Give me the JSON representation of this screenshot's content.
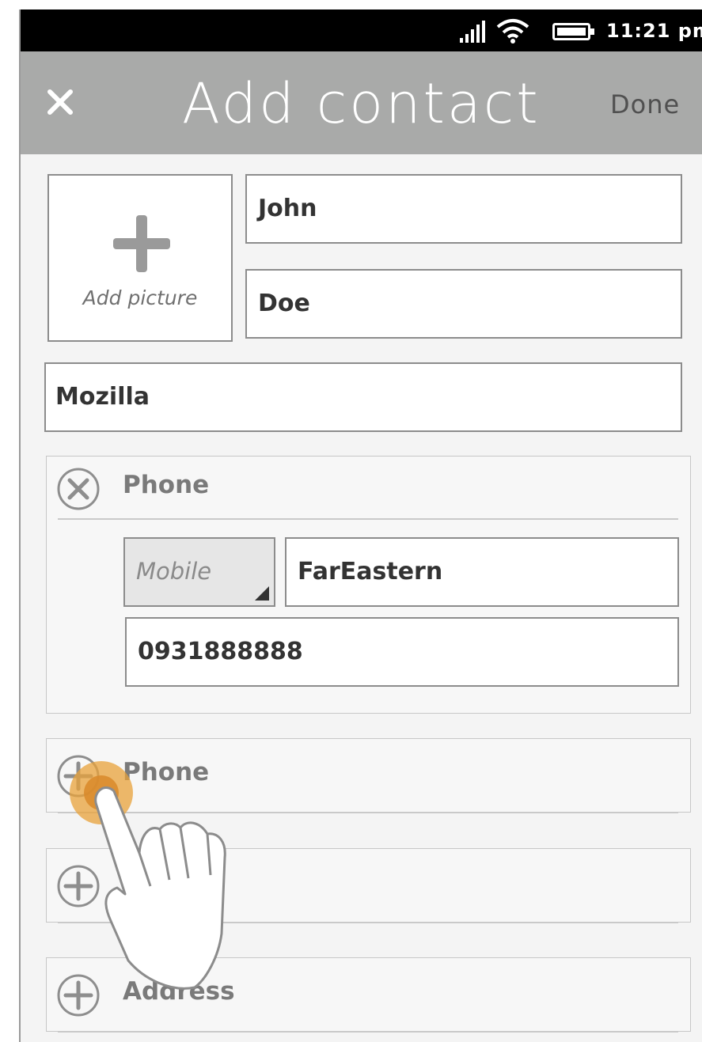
{
  "status_bar": {
    "time": "11:21 pm",
    "icons": [
      "signal-icon",
      "wifi-icon",
      "battery-icon"
    ]
  },
  "header": {
    "title": "Add contact",
    "done_label": "Done",
    "close_icon": "close-icon"
  },
  "avatar": {
    "label": "Add picture",
    "icon": "plus-icon"
  },
  "fields": {
    "given_name": "John",
    "family_name": "Doe",
    "company": "Mozilla"
  },
  "phone_section": {
    "label": "Phone",
    "remove_icon": "remove-circle-icon",
    "type_selected": "Mobile",
    "carrier": "FarEastern",
    "number": "0931888888"
  },
  "add_sections": [
    {
      "label": "Phone",
      "icon": "add-circle-icon"
    },
    {
      "label": "",
      "icon": "add-circle-icon"
    },
    {
      "label": "Address",
      "icon": "add-circle-icon"
    }
  ],
  "colors": {
    "header_bg": "#a9aaa9",
    "status_bg": "#000000",
    "tap_highlight": "#e8a23a",
    "field_border": "#8c8c8c",
    "label_gray": "#7a7a7a"
  }
}
